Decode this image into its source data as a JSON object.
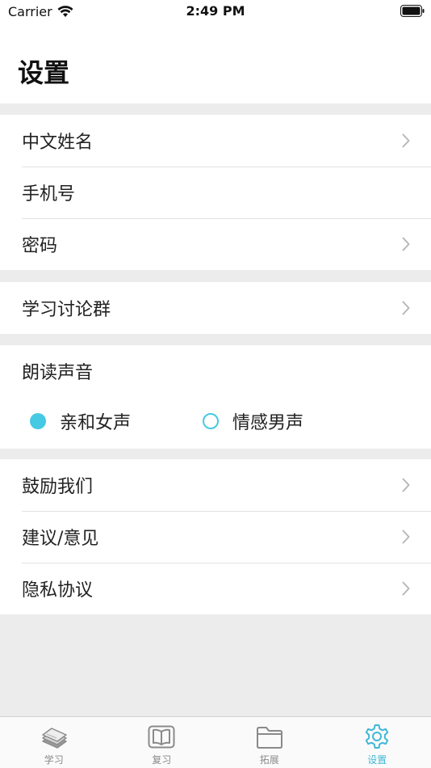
{
  "status_bar": {
    "carrier": "Carrier",
    "time": "2:49 PM"
  },
  "page": {
    "title": "设置"
  },
  "account_group": {
    "items": [
      {
        "label": "中文姓名",
        "has_chevron": true
      },
      {
        "label": "手机号",
        "has_chevron": false
      },
      {
        "label": "密码",
        "has_chevron": true
      }
    ]
  },
  "community_group": {
    "items": [
      {
        "label": "学习讨论群",
        "has_chevron": true
      }
    ]
  },
  "voice": {
    "title": "朗读声音",
    "options": [
      {
        "label": "亲和女声",
        "selected": true
      },
      {
        "label": "情感男声",
        "selected": false
      }
    ]
  },
  "about_group": {
    "items": [
      {
        "label": "鼓励我们",
        "has_chevron": true
      },
      {
        "label": "建议/意见",
        "has_chevron": true
      },
      {
        "label": "隐私协议",
        "has_chevron": true
      }
    ]
  },
  "tab_bar": {
    "tabs": [
      {
        "label": "学习",
        "icon": "book-stack-icon",
        "active": false
      },
      {
        "label": "复习",
        "icon": "open-book-icon",
        "active": false
      },
      {
        "label": "拓展",
        "icon": "folder-icon",
        "active": false
      },
      {
        "label": "设置",
        "icon": "gear-icon",
        "active": true
      }
    ]
  },
  "colors": {
    "accent": "#46c9e3",
    "tab_active": "#3fb8d6",
    "tab_inactive": "#8a8a8a",
    "background": "#ececec"
  }
}
